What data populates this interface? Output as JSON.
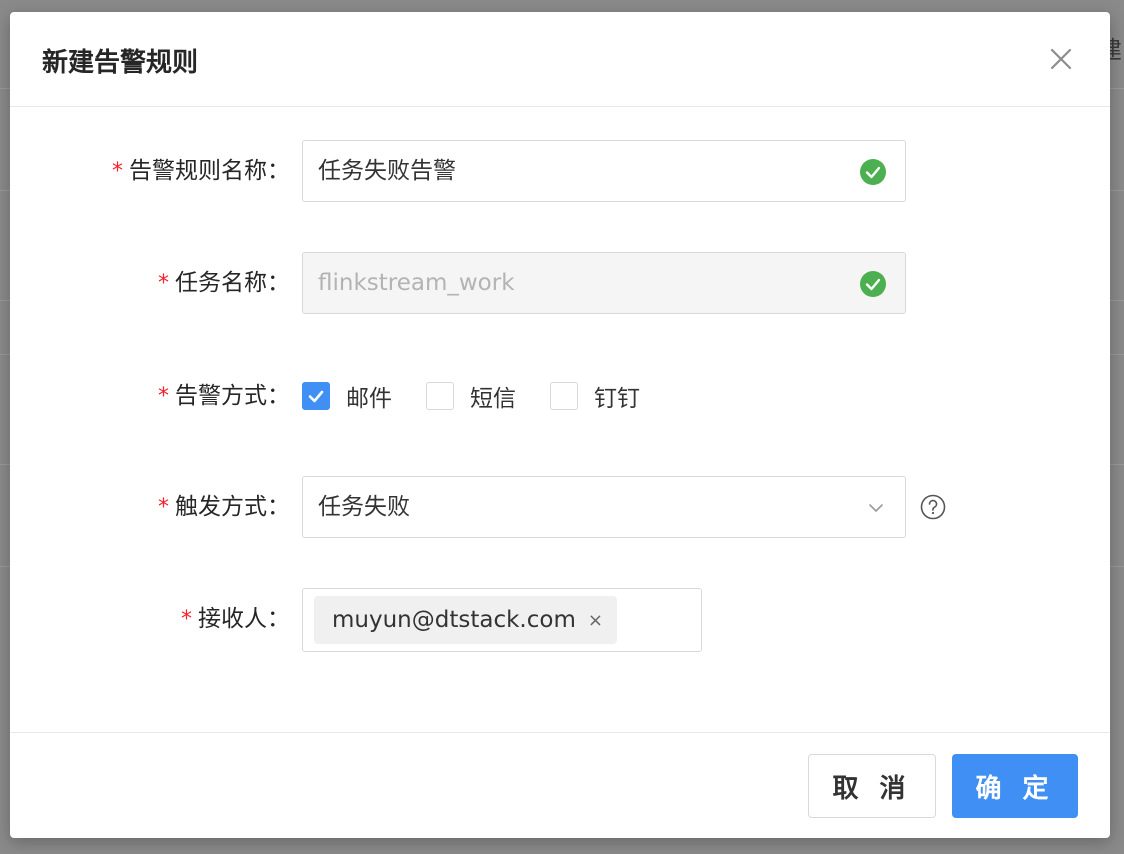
{
  "background": {
    "glyph": "建"
  },
  "modal": {
    "title": "新建告警规则",
    "close_icon": "close-icon"
  },
  "form": {
    "required_mark": "*",
    "rule_name": {
      "label": "告警规则名称：",
      "value": "任务失败告警",
      "status": "valid"
    },
    "task_name": {
      "label": "任务名称：",
      "value": "flinkstream_work",
      "status": "valid",
      "disabled": true
    },
    "alert_method": {
      "label": "告警方式：",
      "options": [
        {
          "label": "邮件",
          "checked": true
        },
        {
          "label": "短信",
          "checked": false
        },
        {
          "label": "钉钉",
          "checked": false
        }
      ]
    },
    "trigger": {
      "label": "触发方式：",
      "value": "任务失败"
    },
    "receivers": {
      "label": "接收人：",
      "tags": [
        "muyun@dtstack.com"
      ],
      "tag_close": "×"
    }
  },
  "footer": {
    "cancel_label": "取 消",
    "ok_label": "确 定"
  },
  "colors": {
    "primary": "#3f8ff5",
    "success": "#52c41a",
    "required": "#f5222d"
  }
}
